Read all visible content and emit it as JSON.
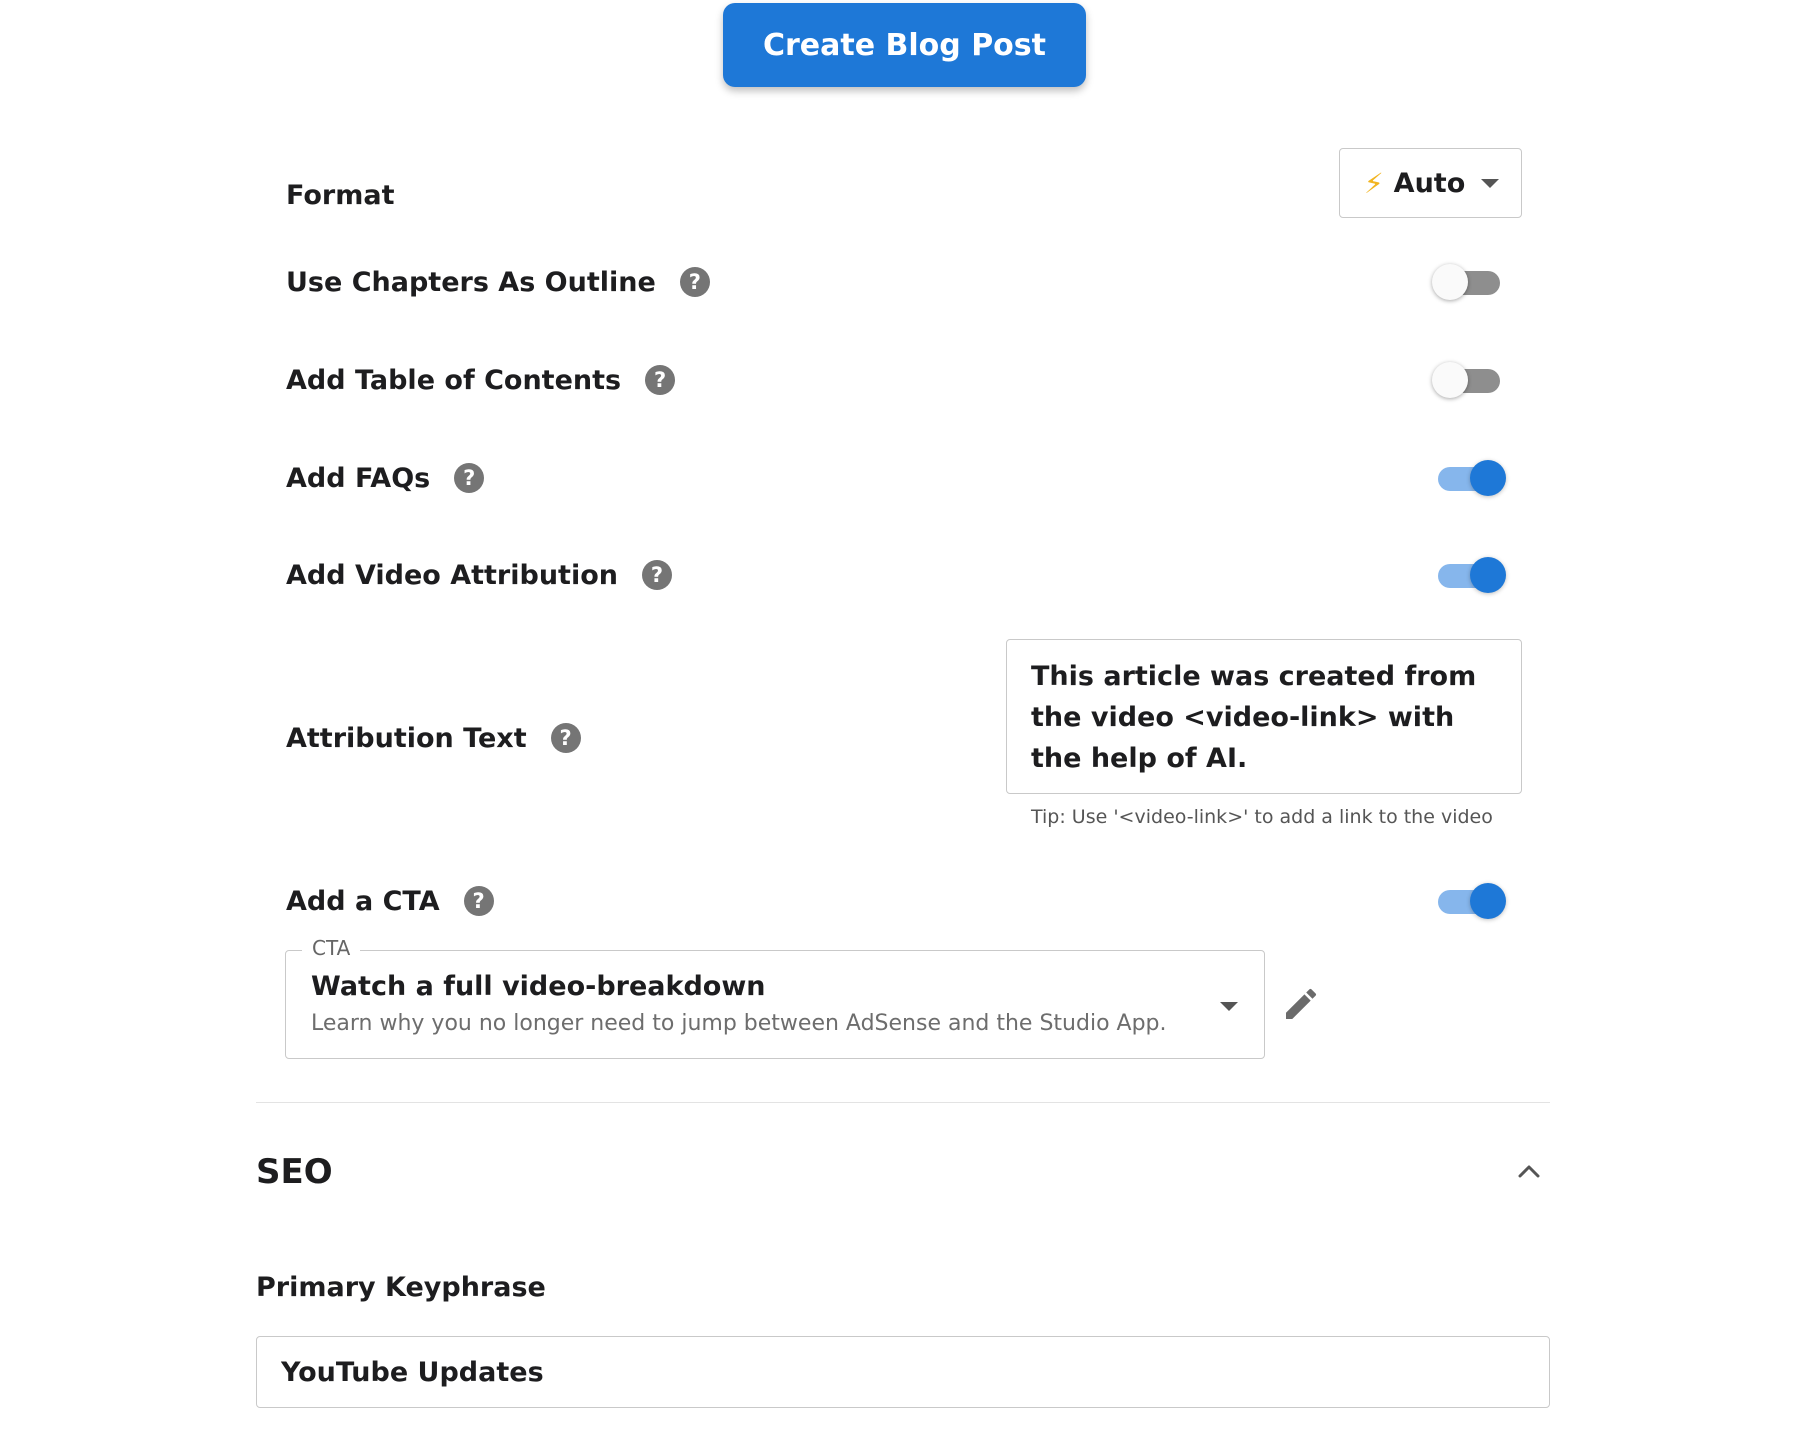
{
  "create_button": {
    "label": "Create Blog Post"
  },
  "format": {
    "label": "Format",
    "selected": "Auto",
    "icon": "lightning-bolt-icon"
  },
  "options": {
    "use_chapters": {
      "label": "Use Chapters As Outline",
      "enabled": false
    },
    "table_of_contents": {
      "label": "Add Table of Contents",
      "enabled": false
    },
    "faqs": {
      "label": "Add FAQs",
      "enabled": true
    },
    "video_attribution": {
      "label": "Add Video Attribution",
      "enabled": true
    }
  },
  "attribution": {
    "label": "Attribution Text",
    "value": "This article was created from the video <video-link> with the help of AI.",
    "tip": "Tip: Use '<video-link>' to add a link to the video"
  },
  "cta": {
    "label": "Add a CTA",
    "enabled": true,
    "field_legend": "CTA",
    "selected_title": "Watch a full video-breakdown",
    "selected_description": "Learn why you no longer need to jump between AdSense and the Studio App."
  },
  "seo": {
    "title": "SEO",
    "primary_keyphrase_label": "Primary Keyphrase",
    "primary_keyphrase_value": "YouTube Updates"
  },
  "colors": {
    "accent": "#1e78d7",
    "toggle_on_track": "#86b6ec",
    "toggle_off_track": "#8e8e8e",
    "help_icon": "#757575",
    "bolt": "#f2b41f"
  }
}
